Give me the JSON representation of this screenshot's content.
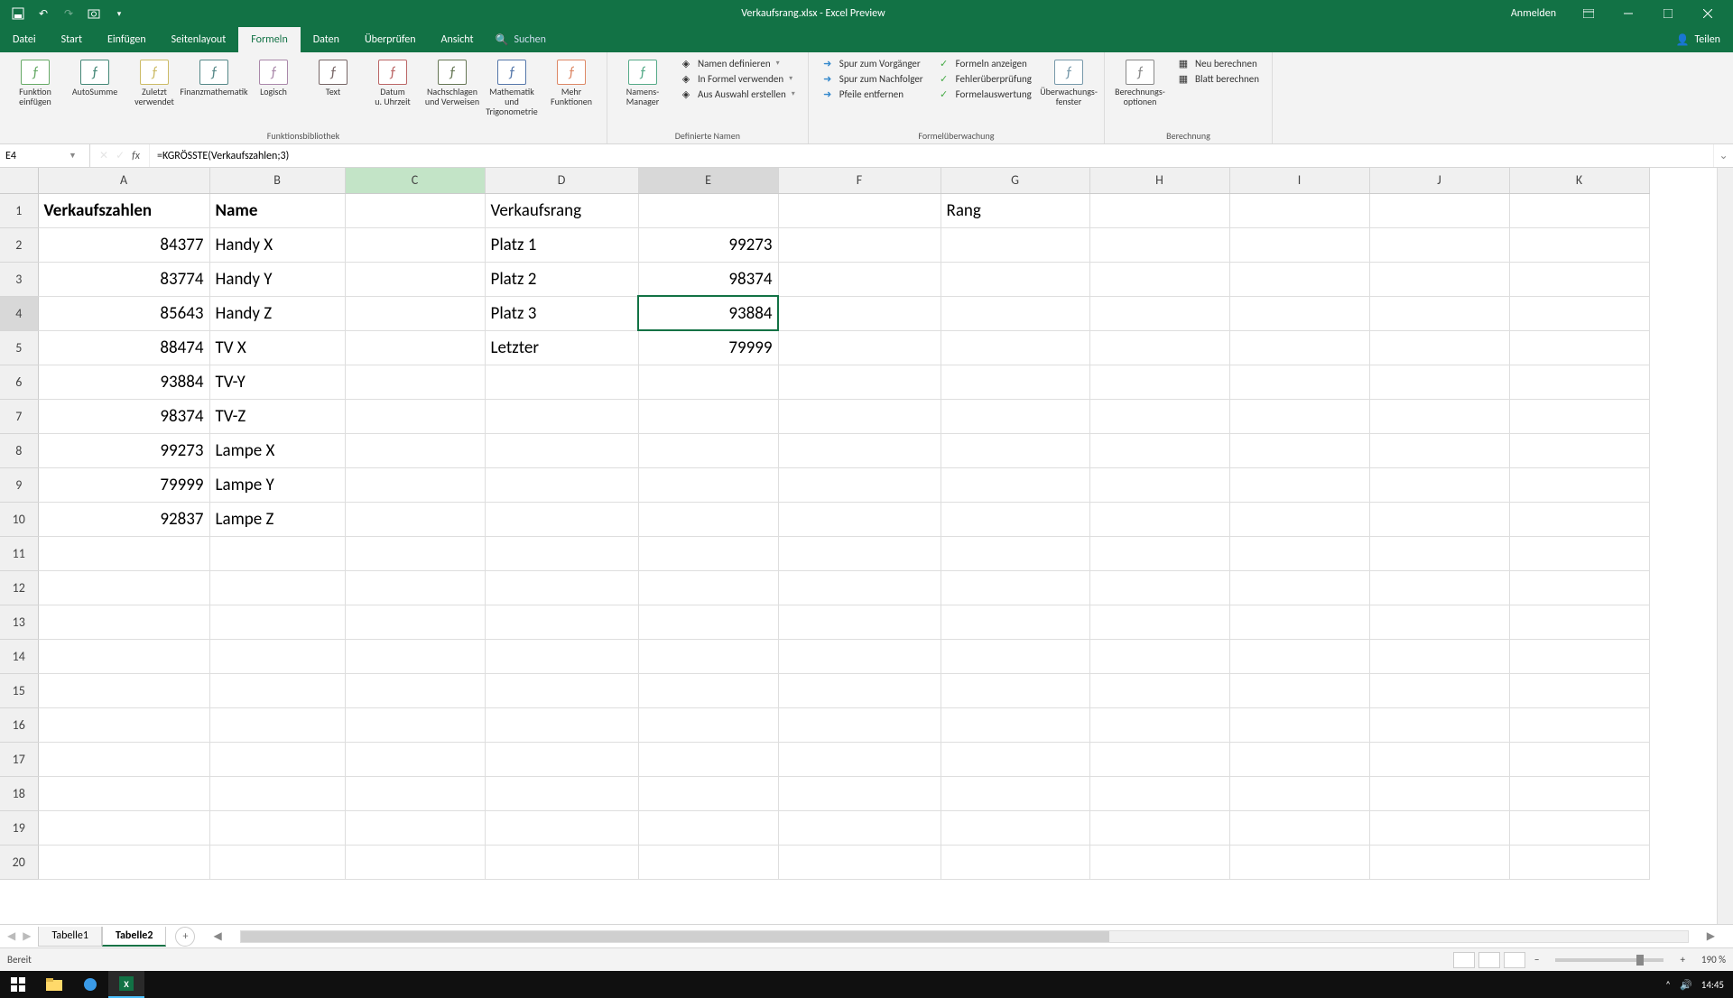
{
  "titlebar": {
    "title": "Verkaufsrang.xlsx - Excel Preview",
    "signin": "Anmelden"
  },
  "tabs": {
    "items": [
      "Datei",
      "Start",
      "Einfügen",
      "Seitenlayout",
      "Formeln",
      "Daten",
      "Überprüfen",
      "Ansicht"
    ],
    "active": 4,
    "search_placeholder": "Suchen",
    "share": "Teilen"
  },
  "ribbon": {
    "g1": {
      "label": "Funktionsbibliothek",
      "btns": [
        "Funktion einfügen",
        "AutoSumme",
        "Zuletzt verwendet",
        "Finanzmathematik",
        "Logisch",
        "Text",
        "Datum u. Uhrzeit",
        "Nachschlagen und Verweisen",
        "Mathematik und Trigonometrie",
        "Mehr Funktionen"
      ]
    },
    "g2": {
      "label": "Definierte Namen",
      "big": "Namens-Manager",
      "items": [
        "Namen definieren",
        "In Formel verwenden",
        "Aus Auswahl erstellen"
      ]
    },
    "g3": {
      "label": "Formelüberwachung",
      "col1": [
        "Spur zum Vorgänger",
        "Spur zum Nachfolger",
        "Pfeile entfernen"
      ],
      "col2": [
        "Formeln anzeigen",
        "Fehlerüberprüfung",
        "Formelauswertung"
      ],
      "big": "Überwachungs-fenster"
    },
    "g4": {
      "label": "Berechnung",
      "big": "Berechnungs-optionen",
      "items": [
        "Neu berechnen",
        "Blatt berechnen"
      ]
    }
  },
  "formula_bar": {
    "name_box": "E4",
    "formula": "=KGRÖSSTE(Verkaufszahlen;3)"
  },
  "sheet": {
    "cols": [
      "A",
      "B",
      "C",
      "D",
      "E",
      "F",
      "G",
      "H",
      "I",
      "J",
      "K"
    ],
    "row_count": 20,
    "hovered_col": "C",
    "selected": {
      "col": "E",
      "row": 4
    },
    "data": {
      "A1": {
        "v": "Verkaufszahlen",
        "bold": true
      },
      "B1": {
        "v": "Name",
        "bold": true
      },
      "D1": {
        "v": "Verkaufsrang"
      },
      "G1": {
        "v": "Rang"
      },
      "A2": {
        "v": "84377",
        "num": true
      },
      "B2": {
        "v": "Handy X"
      },
      "D2": {
        "v": "Platz 1"
      },
      "E2": {
        "v": "99273",
        "num": true
      },
      "A3": {
        "v": "83774",
        "num": true
      },
      "B3": {
        "v": "Handy Y"
      },
      "D3": {
        "v": "Platz 2"
      },
      "E3": {
        "v": "98374",
        "num": true
      },
      "A4": {
        "v": "85643",
        "num": true
      },
      "B4": {
        "v": "Handy Z"
      },
      "D4": {
        "v": "Platz 3"
      },
      "E4": {
        "v": "93884",
        "num": true
      },
      "A5": {
        "v": "88474",
        "num": true
      },
      "B5": {
        "v": "TV X"
      },
      "D5": {
        "v": "Letzter"
      },
      "E5": {
        "v": "79999",
        "num": true
      },
      "A6": {
        "v": "93884",
        "num": true
      },
      "B6": {
        "v": "TV-Y"
      },
      "A7": {
        "v": "98374",
        "num": true
      },
      "B7": {
        "v": "TV-Z"
      },
      "A8": {
        "v": "99273",
        "num": true
      },
      "B8": {
        "v": "Lampe X"
      },
      "A9": {
        "v": "79999",
        "num": true
      },
      "B9": {
        "v": "Lampe Y"
      },
      "A10": {
        "v": "92837",
        "num": true
      },
      "B10": {
        "v": "Lampe Z"
      }
    }
  },
  "sheet_tabs": {
    "items": [
      "Tabelle1",
      "Tabelle2"
    ],
    "active": 1
  },
  "statusbar": {
    "status": "Bereit",
    "zoom": "190 %"
  },
  "taskbar": {
    "time": "14:45"
  }
}
